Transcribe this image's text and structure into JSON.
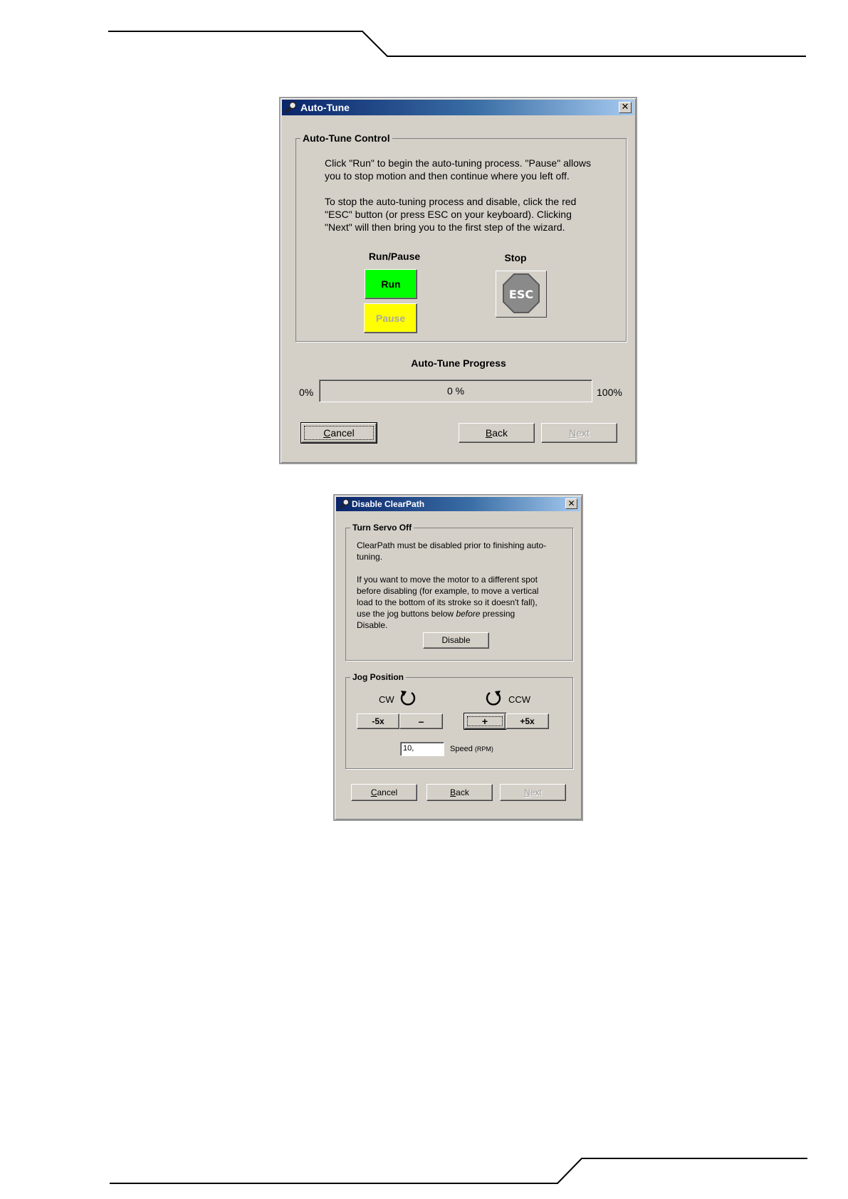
{
  "dialog1": {
    "title": "Auto-Tune",
    "close_glyph": "✕",
    "group_label": "Auto-Tune Control",
    "para1_line1": "Click \"Run\" to begin the auto-tuning process. \"Pause\" allows",
    "para1_line2": "you to stop motion and then continue where you left off.",
    "para2_line1": "To stop the auto-tuning process and disable, click the red",
    "para2_line2": "\"ESC\" button (or press ESC on your keyboard). Clicking",
    "para2_line3": "\"Next\" will then bring you to the first step of the wizard.",
    "run_pause_label": "Run/Pause",
    "stop_label": "Stop",
    "run_button": "Run",
    "pause_button": "Pause",
    "esc_button": "ESC",
    "progress_label": "Auto-Tune Progress",
    "progress_min": "0%",
    "progress_max": "100%",
    "progress_text": "0 %",
    "progress_value": 0,
    "cancel_button_first": "C",
    "cancel_button_rest": "ancel",
    "back_button_first": "B",
    "back_button_rest": "ack",
    "next_button_first": "N",
    "next_button_rest": "ext"
  },
  "dialog2": {
    "title": "Disable ClearPath",
    "close_glyph": "✕",
    "group1_label": "Turn Servo Off",
    "t1_line1": "ClearPath must be disabled prior to finishing auto-",
    "t1_line2": "tuning.",
    "t2_line1": "If you want to move the motor to a different spot",
    "t2_line2": "before disabling (for example, to move a vertical",
    "t2_line3": "load to the bottom of its stroke so it doesn't fall),",
    "t2_line4_pre": "use the jog buttons below ",
    "t2_line4_em": "before",
    "t2_line4_post": " pressing",
    "t2_line5": "Disable.",
    "disable_button": "Disable",
    "group2_label": "Jog Position",
    "cw_label": "CW",
    "ccw_label": "CCW",
    "jog_minus5x": "-5x",
    "jog_minus": "–",
    "jog_plus": "+",
    "jog_plus5x": "+5x",
    "speed_value": "10,",
    "speed_label": "Speed",
    "speed_unit": "(RPM)",
    "cancel_button_first": "C",
    "cancel_button_rest": "ancel",
    "back_button_first": "B",
    "back_button_rest": "ack",
    "next_button_first": "N",
    "next_button_rest": "ext"
  },
  "icons": {
    "title_icon": "wrench-magnifier-icon",
    "cw_icon": "rotate-clockwise-icon",
    "ccw_icon": "rotate-counterclockwise-icon",
    "stop_icon": "stop-octagon-icon"
  }
}
